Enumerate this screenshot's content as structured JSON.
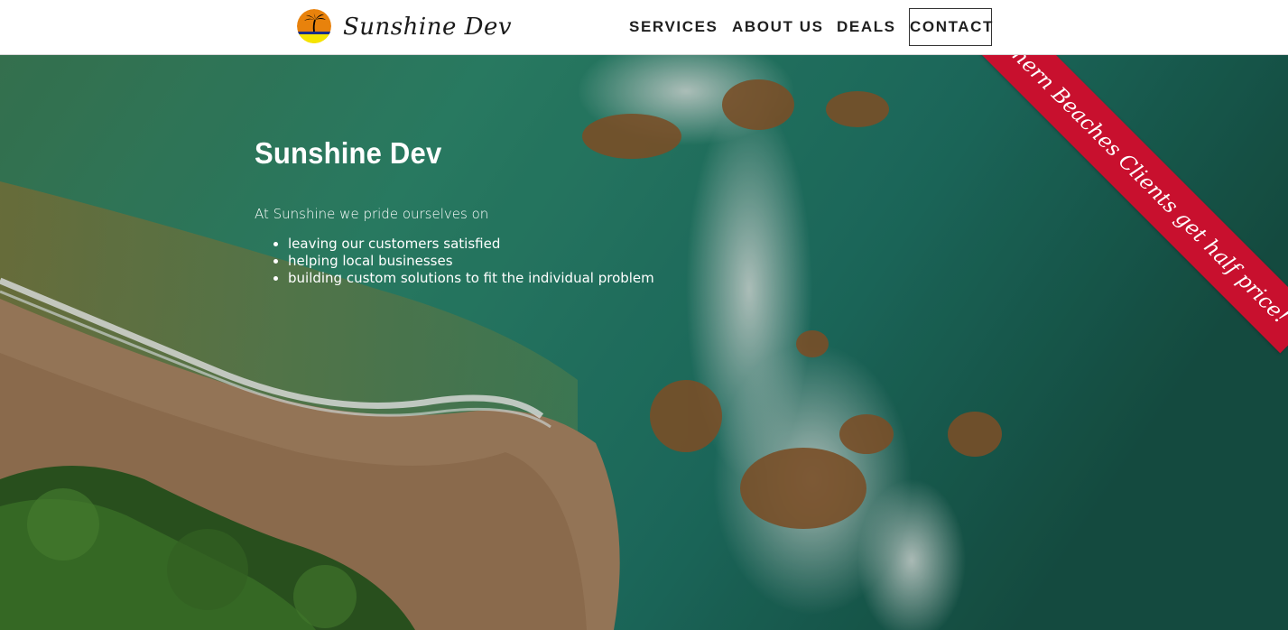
{
  "header": {
    "logo_icon": "sunset-palm-icon",
    "site_name": "Sunshine Dev",
    "nav": {
      "services": "SERVICES",
      "about": "ABOUT US",
      "deals": "DEALS",
      "contact": "CONTACT"
    }
  },
  "hero": {
    "title": "Sunshine Dev",
    "intro": "At Sunshine we pride ourselves on",
    "points": [
      "leaving our customers satisfied",
      "helping local businesses",
      "building custom solutions to fit the individual problem"
    ]
  },
  "ribbon": {
    "text": "Northern Beaches Clients get half price!",
    "color": "#c8102e"
  },
  "colors": {
    "header_bg": "#ffffff",
    "nav_text": "#1f1f1f",
    "hero_text": "#ffffff",
    "logo_orange": "#e8820c",
    "logo_yellow": "#f5e400",
    "logo_blue": "#1a2f8a"
  }
}
